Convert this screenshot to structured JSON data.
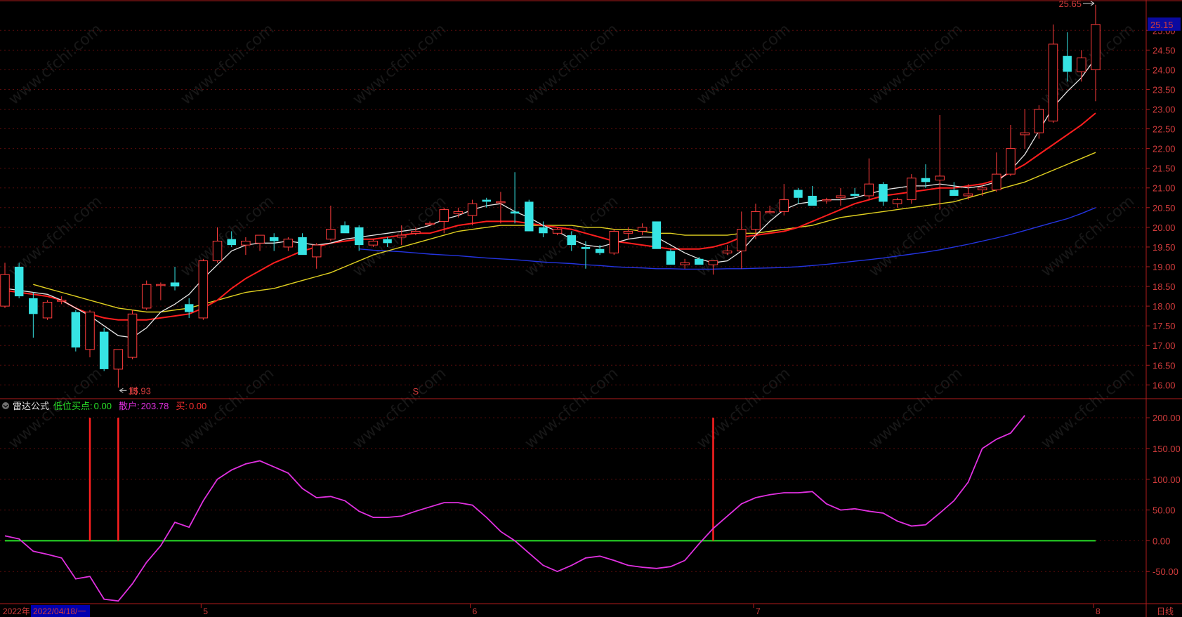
{
  "window": {
    "period_label": "日线"
  },
  "price_panel": {
    "current_price_label": "25.15",
    "high_marker": "25.65",
    "low_marker": "15.93",
    "marker_cai": "财",
    "marker_s": "S"
  },
  "indicator_panel": {
    "name": "雷达公式",
    "low_buy_label": "低位买点:",
    "low_buy_value": "0.00",
    "retail_label": "散户:",
    "retail_value": "203.78",
    "buy_label": "买:",
    "buy_value": "0.00"
  },
  "date_axis": {
    "start_label": "2022年",
    "cursor_label": "2022/04/18/一",
    "month_labels": [
      "5",
      "6",
      "7",
      "8"
    ]
  },
  "watermark_text": "www.cfchi.com",
  "colors": {
    "up": "#ff3c3c",
    "down": "#36e4e4",
    "ma_white": "#e6e6e6",
    "ma_red": "#ff1e1e",
    "ma_yellow": "#e0d020",
    "ma_blue": "#2434e0",
    "magenta": "#e030e0",
    "green": "#28e028",
    "signal_red": "#ff2020",
    "background": "#000000"
  },
  "chart_data": [
    {
      "type": "candlestick",
      "ylim": [
        15.65,
        25.45
      ],
      "yticks": [
        "16.00",
        "16.50",
        "17.00",
        "17.50",
        "18.00",
        "18.50",
        "19.00",
        "19.50",
        "20.00",
        "20.50",
        "21.00",
        "21.50",
        "22.00",
        "22.50",
        "23.00",
        "23.50",
        "24.00",
        "24.50",
        "25.00"
      ],
      "candles": [
        {
          "o": 18.0,
          "h": 19.1,
          "l": 17.95,
          "c": 18.8
        },
        {
          "o": 19.0,
          "h": 19.1,
          "l": 18.2,
          "c": 18.25
        },
        {
          "o": 18.2,
          "h": 18.35,
          "l": 17.2,
          "c": 17.8
        },
        {
          "o": 17.7,
          "h": 18.15,
          "l": 17.65,
          "c": 18.1
        },
        {
          "o": 18.15,
          "h": 18.25,
          "l": 18.05,
          "c": 18.15
        },
        {
          "o": 17.85,
          "h": 17.9,
          "l": 16.85,
          "c": 16.95
        },
        {
          "o": 16.9,
          "h": 17.9,
          "l": 16.7,
          "c": 17.85
        },
        {
          "o": 17.35,
          "h": 17.45,
          "l": 16.35,
          "c": 16.4
        },
        {
          "o": 16.4,
          "h": 16.9,
          "l": 15.93,
          "c": 16.9
        },
        {
          "o": 16.7,
          "h": 17.9,
          "l": 16.65,
          "c": 17.8
        },
        {
          "o": 17.95,
          "h": 18.65,
          "l": 17.9,
          "c": 18.55
        },
        {
          "o": 18.55,
          "h": 18.6,
          "l": 18.15,
          "c": 18.55
        },
        {
          "o": 18.6,
          "h": 19.0,
          "l": 18.4,
          "c": 18.5
        },
        {
          "o": 18.05,
          "h": 18.2,
          "l": 17.7,
          "c": 17.85
        },
        {
          "o": 17.7,
          "h": 19.2,
          "l": 17.65,
          "c": 19.15
        },
        {
          "o": 19.15,
          "h": 20.0,
          "l": 19.1,
          "c": 19.65
        },
        {
          "o": 19.7,
          "h": 19.9,
          "l": 19.5,
          "c": 19.55
        },
        {
          "o": 19.55,
          "h": 19.75,
          "l": 19.3,
          "c": 19.65
        },
        {
          "o": 19.6,
          "h": 19.8,
          "l": 19.4,
          "c": 19.8
        },
        {
          "o": 19.75,
          "h": 19.85,
          "l": 19.4,
          "c": 19.65
        },
        {
          "o": 19.5,
          "h": 19.75,
          "l": 19.4,
          "c": 19.7
        },
        {
          "o": 19.75,
          "h": 19.85,
          "l": 19.3,
          "c": 19.3
        },
        {
          "o": 19.25,
          "h": 19.6,
          "l": 18.95,
          "c": 19.55
        },
        {
          "o": 19.7,
          "h": 20.55,
          "l": 19.65,
          "c": 19.95
        },
        {
          "o": 20.05,
          "h": 20.15,
          "l": 19.85,
          "c": 19.85
        },
        {
          "o": 20.0,
          "h": 20.05,
          "l": 19.4,
          "c": 19.55
        },
        {
          "o": 19.55,
          "h": 19.7,
          "l": 19.5,
          "c": 19.65
        },
        {
          "o": 19.7,
          "h": 19.75,
          "l": 19.5,
          "c": 19.6
        },
        {
          "o": 19.75,
          "h": 20.05,
          "l": 19.55,
          "c": 19.8
        },
        {
          "o": 19.85,
          "h": 20.0,
          "l": 19.8,
          "c": 19.9
        },
        {
          "o": 20.1,
          "h": 20.15,
          "l": 20.05,
          "c": 20.1
        },
        {
          "o": 20.15,
          "h": 20.5,
          "l": 19.85,
          "c": 20.45
        },
        {
          "o": 20.35,
          "h": 20.5,
          "l": 20.25,
          "c": 20.4
        },
        {
          "o": 20.3,
          "h": 20.7,
          "l": 20.05,
          "c": 20.6
        },
        {
          "o": 20.7,
          "h": 20.75,
          "l": 20.5,
          "c": 20.65
        },
        {
          "o": 20.65,
          "h": 20.9,
          "l": 20.1,
          "c": 20.65
        },
        {
          "o": 20.4,
          "h": 21.4,
          "l": 20.1,
          "c": 20.35
        },
        {
          "o": 20.65,
          "h": 20.7,
          "l": 19.95,
          "c": 19.9
        },
        {
          "o": 20.0,
          "h": 20.15,
          "l": 19.75,
          "c": 19.85
        },
        {
          "o": 19.85,
          "h": 20.0,
          "l": 19.8,
          "c": 19.95
        },
        {
          "o": 19.8,
          "h": 19.9,
          "l": 19.4,
          "c": 19.55
        },
        {
          "o": 19.5,
          "h": 19.65,
          "l": 18.95,
          "c": 19.45
        },
        {
          "o": 19.45,
          "h": 19.55,
          "l": 19.3,
          "c": 19.35
        },
        {
          "o": 19.35,
          "h": 19.95,
          "l": 19.3,
          "c": 19.9
        },
        {
          "o": 19.85,
          "h": 20.0,
          "l": 19.7,
          "c": 19.9
        },
        {
          "o": 19.9,
          "h": 20.1,
          "l": 19.8,
          "c": 20.0
        },
        {
          "o": 20.15,
          "h": 20.15,
          "l": 19.45,
          "c": 19.45
        },
        {
          "o": 19.4,
          "h": 19.45,
          "l": 19.05,
          "c": 19.05
        },
        {
          "o": 19.05,
          "h": 19.2,
          "l": 18.95,
          "c": 19.1
        },
        {
          "o": 19.2,
          "h": 19.25,
          "l": 19.05,
          "c": 19.05
        },
        {
          "o": 19.05,
          "h": 19.15,
          "l": 18.8,
          "c": 19.15
        },
        {
          "o": 19.35,
          "h": 19.55,
          "l": 19.3,
          "c": 19.4
        },
        {
          "o": 19.4,
          "h": 20.4,
          "l": 18.95,
          "c": 19.95
        },
        {
          "o": 19.95,
          "h": 20.6,
          "l": 19.7,
          "c": 20.4
        },
        {
          "o": 20.4,
          "h": 20.55,
          "l": 20.35,
          "c": 20.4
        },
        {
          "o": 20.4,
          "h": 21.1,
          "l": 20.3,
          "c": 20.7
        },
        {
          "o": 20.95,
          "h": 21.0,
          "l": 20.6,
          "c": 20.75
        },
        {
          "o": 20.8,
          "h": 21.05,
          "l": 20.55,
          "c": 20.55
        },
        {
          "o": 20.7,
          "h": 20.75,
          "l": 20.6,
          "c": 20.7
        },
        {
          "o": 20.75,
          "h": 21.0,
          "l": 20.55,
          "c": 20.8
        },
        {
          "o": 20.85,
          "h": 21.0,
          "l": 20.75,
          "c": 20.8
        },
        {
          "o": 20.8,
          "h": 21.75,
          "l": 20.7,
          "c": 21.1
        },
        {
          "o": 21.1,
          "h": 21.15,
          "l": 20.55,
          "c": 20.65
        },
        {
          "o": 20.6,
          "h": 20.75,
          "l": 20.5,
          "c": 20.7
        },
        {
          "o": 20.7,
          "h": 21.35,
          "l": 20.6,
          "c": 21.25
        },
        {
          "o": 21.25,
          "h": 21.6,
          "l": 21.0,
          "c": 21.15
        },
        {
          "o": 21.2,
          "h": 22.85,
          "l": 20.45,
          "c": 21.3
        },
        {
          "o": 20.95,
          "h": 21.15,
          "l": 20.85,
          "c": 20.8
        },
        {
          "o": 20.8,
          "h": 21.1,
          "l": 20.7,
          "c": 20.85
        },
        {
          "o": 20.95,
          "h": 21.05,
          "l": 20.8,
          "c": 21.0
        },
        {
          "o": 20.95,
          "h": 21.9,
          "l": 20.9,
          "c": 21.35
        },
        {
          "o": 21.35,
          "h": 22.6,
          "l": 21.3,
          "c": 22.0
        },
        {
          "o": 22.35,
          "h": 23.0,
          "l": 22.0,
          "c": 22.4
        },
        {
          "o": 22.4,
          "h": 23.1,
          "l": 22.25,
          "c": 23.0
        },
        {
          "o": 22.7,
          "h": 25.15,
          "l": 22.65,
          "c": 24.65
        },
        {
          "o": 24.35,
          "h": 24.95,
          "l": 23.7,
          "c": 23.95
        },
        {
          "o": 23.95,
          "h": 24.5,
          "l": 23.7,
          "c": 24.3
        },
        {
          "o": 24.0,
          "h": 25.65,
          "l": 23.2,
          "c": 25.15
        }
      ],
      "ma_white": [
        18.45,
        18.4,
        18.35,
        18.3,
        18.15,
        17.95,
        17.75,
        17.5,
        17.25,
        17.2,
        17.45,
        17.85,
        18.05,
        18.3,
        18.7,
        19.05,
        19.4,
        19.55,
        19.6,
        19.6,
        19.65,
        19.6,
        19.55,
        19.6,
        19.7,
        19.75,
        19.8,
        19.85,
        19.9,
        19.95,
        20.05,
        20.2,
        20.3,
        20.45,
        20.55,
        20.6,
        20.4,
        20.25,
        20.05,
        19.9,
        19.7,
        19.55,
        19.5,
        19.6,
        19.7,
        19.75,
        19.75,
        19.55,
        19.35,
        19.2,
        19.1,
        19.15,
        19.4,
        19.8,
        20.15,
        20.45,
        20.6,
        20.65,
        20.7,
        20.7,
        20.75,
        20.85,
        20.95,
        21.0,
        21.05,
        21.05,
        21.1,
        21.05,
        21.0,
        21.05,
        21.15,
        21.45,
        21.85,
        22.45,
        23.05,
        23.45,
        23.8,
        24.3
      ],
      "ma_red": [
        18.4,
        18.35,
        18.3,
        18.25,
        18.15,
        17.95,
        17.8,
        17.7,
        17.65,
        17.65,
        17.65,
        17.7,
        17.75,
        17.8,
        17.95,
        18.15,
        18.45,
        18.7,
        18.9,
        19.1,
        19.25,
        19.4,
        19.5,
        19.6,
        19.65,
        19.7,
        19.7,
        19.75,
        19.8,
        19.85,
        19.85,
        19.95,
        20.05,
        20.1,
        20.15,
        20.15,
        20.15,
        20.1,
        20.05,
        20.0,
        19.95,
        19.85,
        19.75,
        19.65,
        19.6,
        19.55,
        19.5,
        19.45,
        19.45,
        19.45,
        19.5,
        19.6,
        19.75,
        19.8,
        19.85,
        19.9,
        20.0,
        20.15,
        20.3,
        20.45,
        20.6,
        20.7,
        20.8,
        20.85,
        20.9,
        20.95,
        21.0,
        21.0,
        21.05,
        21.1,
        21.2,
        21.4,
        21.6,
        21.85,
        22.1,
        22.35,
        22.6,
        22.9
      ],
      "ma_yellow": [
        18.55,
        18.45,
        18.35,
        18.25,
        18.15,
        18.05,
        17.95,
        17.9,
        17.85,
        17.85,
        17.9,
        17.95,
        18.05,
        18.15,
        18.25,
        18.35,
        18.4,
        18.45,
        18.55,
        18.65,
        18.75,
        18.85,
        19.0,
        19.15,
        19.3,
        19.4,
        19.5,
        19.6,
        19.7,
        19.8,
        19.9,
        19.95,
        20.0,
        20.05,
        20.05,
        20.05,
        20.05,
        20.05,
        20.05,
        20.0,
        20.0,
        19.95,
        19.95,
        19.9,
        19.85,
        19.85,
        19.8,
        19.8,
        19.8,
        19.8,
        19.85,
        19.85,
        19.9,
        19.95,
        20.0,
        20.05,
        20.15,
        20.25,
        20.3,
        20.35,
        20.4,
        20.45,
        20.5,
        20.55,
        20.6,
        20.65,
        20.75,
        20.85,
        20.95,
        21.05,
        21.15,
        21.3,
        21.45,
        21.6,
        21.75,
        21.9
      ],
      "ma_blue": [
        19.45,
        19.42,
        19.4,
        19.38,
        19.35,
        19.32,
        19.3,
        19.28,
        19.25,
        19.22,
        19.2,
        19.18,
        19.15,
        19.12,
        19.1,
        19.08,
        19.05,
        19.03,
        19.0,
        18.98,
        18.97,
        18.95,
        18.95,
        18.94,
        18.94,
        18.94,
        18.95,
        18.95,
        18.96,
        18.97,
        18.98,
        19.0,
        19.03,
        19.06,
        19.1,
        19.14,
        19.18,
        19.22,
        19.27,
        19.32,
        19.37,
        19.43,
        19.5,
        19.57,
        19.65,
        19.73,
        19.82,
        19.92,
        20.02,
        20.12,
        20.22,
        20.35,
        20.5
      ]
    },
    {
      "type": "line",
      "title": "雷达公式",
      "ylim": [
        -100,
        215
      ],
      "yticks": [
        "200.00",
        "150.00",
        "100.00",
        "50.00",
        "0.00",
        "-50.00"
      ],
      "series": [
        {
          "name": "散户",
          "values": [
            8,
            3,
            -17,
            -22,
            -28,
            -62,
            -58,
            -95,
            -98,
            -70,
            -35,
            -8,
            30,
            22,
            65,
            100,
            115,
            125,
            130,
            120,
            110,
            85,
            70,
            72,
            65,
            48,
            38,
            38,
            40,
            48,
            55,
            62,
            62,
            58,
            38,
            15,
            0,
            -20,
            -40,
            -50,
            -40,
            -28,
            -25,
            -32,
            -40,
            -43,
            -45,
            -42,
            -32,
            -5,
            20,
            40,
            60,
            70,
            75,
            78,
            78,
            80,
            60,
            50,
            52,
            48,
            45,
            32,
            24,
            26,
            45,
            65,
            95,
            150,
            165,
            175,
            203.78
          ]
        },
        {
          "name": "低位买点",
          "values": [
            0
          ]
        },
        {
          "name": "买",
          "values": [
            0
          ]
        }
      ],
      "signals_at_index": [
        6,
        8,
        50
      ]
    }
  ]
}
